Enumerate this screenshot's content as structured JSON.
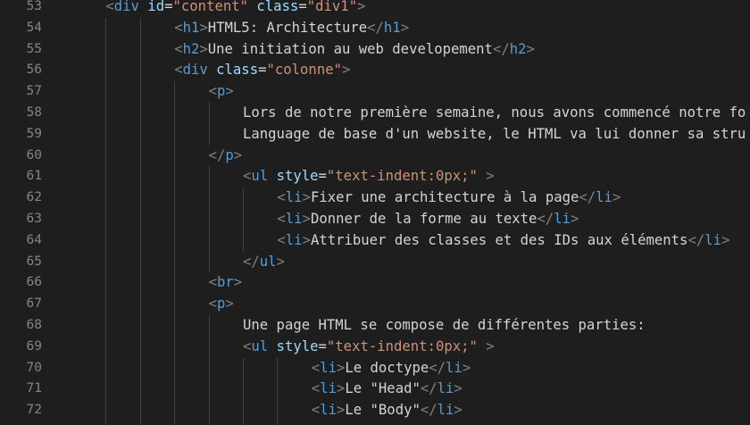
{
  "colors": {
    "background": "#1e1e1e",
    "line_number": "#858585",
    "indent_guide": "#404040",
    "punct": "#808080",
    "tag": "#569cd6",
    "attr": "#9cdcfe",
    "string": "#ce9178",
    "text": "#d4d4d4"
  },
  "lines": [
    {
      "n": "53",
      "indent": 1,
      "tokens": [
        [
          "punct",
          "<"
        ],
        [
          "tag",
          "div"
        ],
        [
          "text",
          " "
        ],
        [
          "attr",
          "id"
        ],
        [
          "text",
          "="
        ],
        [
          "string",
          "\"content\""
        ],
        [
          "text",
          " "
        ],
        [
          "attr",
          "class"
        ],
        [
          "text",
          "="
        ],
        [
          "string",
          "\"div1\""
        ],
        [
          "punct",
          ">"
        ]
      ]
    },
    {
      "n": "54",
      "indent": 3,
      "tokens": [
        [
          "punct",
          "<"
        ],
        [
          "tag",
          "h1"
        ],
        [
          "punct",
          ">"
        ],
        [
          "text",
          "HTML5: Architecture"
        ],
        [
          "punct",
          "</"
        ],
        [
          "tag",
          "h1"
        ],
        [
          "punct",
          ">"
        ]
      ]
    },
    {
      "n": "55",
      "indent": 3,
      "tokens": [
        [
          "punct",
          "<"
        ],
        [
          "tag",
          "h2"
        ],
        [
          "punct",
          ">"
        ],
        [
          "text",
          "Une initiation au web developement"
        ],
        [
          "punct",
          "</"
        ],
        [
          "tag",
          "h2"
        ],
        [
          "punct",
          ">"
        ]
      ]
    },
    {
      "n": "56",
      "indent": 3,
      "tokens": [
        [
          "punct",
          "<"
        ],
        [
          "tag",
          "div"
        ],
        [
          "text",
          " "
        ],
        [
          "attr",
          "class"
        ],
        [
          "text",
          "="
        ],
        [
          "string",
          "\"colonne\""
        ],
        [
          "punct",
          ">"
        ]
      ]
    },
    {
      "n": "57",
      "indent": 4,
      "tokens": [
        [
          "punct",
          "<"
        ],
        [
          "tag",
          "p"
        ],
        [
          "punct",
          ">"
        ]
      ]
    },
    {
      "n": "58",
      "indent": 5,
      "tokens": [
        [
          "text",
          "Lors de notre première semaine, nous avons commencé notre fo"
        ]
      ]
    },
    {
      "n": "59",
      "indent": 5,
      "tokens": [
        [
          "text",
          "Language de base d'un website, le HTML va lui donner sa stru"
        ]
      ]
    },
    {
      "n": "60",
      "indent": 4,
      "tokens": [
        [
          "punct",
          "</"
        ],
        [
          "tag",
          "p"
        ],
        [
          "punct",
          ">"
        ]
      ]
    },
    {
      "n": "61",
      "indent": 5,
      "tokens": [
        [
          "punct",
          "<"
        ],
        [
          "tag",
          "ul"
        ],
        [
          "text",
          " "
        ],
        [
          "attr",
          "style"
        ],
        [
          "text",
          "="
        ],
        [
          "string",
          "\"text-indent:0px;\""
        ],
        [
          "text",
          " "
        ],
        [
          "punct",
          ">"
        ]
      ]
    },
    {
      "n": "62",
      "indent": 6,
      "tokens": [
        [
          "punct",
          "<"
        ],
        [
          "tag",
          "li"
        ],
        [
          "punct",
          ">"
        ],
        [
          "text",
          "Fixer une architecture à la page"
        ],
        [
          "punct",
          "</"
        ],
        [
          "tag",
          "li"
        ],
        [
          "punct",
          ">"
        ]
      ]
    },
    {
      "n": "63",
      "indent": 6,
      "tokens": [
        [
          "punct",
          "<"
        ],
        [
          "tag",
          "li"
        ],
        [
          "punct",
          ">"
        ],
        [
          "text",
          "Donner de la forme au texte"
        ],
        [
          "punct",
          "</"
        ],
        [
          "tag",
          "li"
        ],
        [
          "punct",
          ">"
        ]
      ]
    },
    {
      "n": "64",
      "indent": 6,
      "tokens": [
        [
          "punct",
          "<"
        ],
        [
          "tag",
          "li"
        ],
        [
          "punct",
          ">"
        ],
        [
          "text",
          "Attribuer des classes et des IDs aux éléments"
        ],
        [
          "punct",
          "</"
        ],
        [
          "tag",
          "li"
        ],
        [
          "punct",
          ">"
        ]
      ]
    },
    {
      "n": "65",
      "indent": 5,
      "tokens": [
        [
          "punct",
          "</"
        ],
        [
          "tag",
          "ul"
        ],
        [
          "punct",
          ">"
        ]
      ]
    },
    {
      "n": "66",
      "indent": 4,
      "tokens": [
        [
          "punct",
          "<"
        ],
        [
          "tag",
          "br"
        ],
        [
          "punct",
          ">"
        ]
      ]
    },
    {
      "n": "67",
      "indent": 4,
      "tokens": [
        [
          "punct",
          "<"
        ],
        [
          "tag",
          "p"
        ],
        [
          "punct",
          ">"
        ]
      ]
    },
    {
      "n": "68",
      "indent": 5,
      "tokens": [
        [
          "text",
          "Une page HTML se compose de différentes parties:"
        ]
      ]
    },
    {
      "n": "69",
      "indent": 5,
      "tokens": [
        [
          "punct",
          "<"
        ],
        [
          "tag",
          "ul"
        ],
        [
          "text",
          " "
        ],
        [
          "attr",
          "style"
        ],
        [
          "text",
          "="
        ],
        [
          "string",
          "\"text-indent:0px;\""
        ],
        [
          "text",
          " "
        ],
        [
          "punct",
          ">"
        ]
      ]
    },
    {
      "n": "70",
      "indent": 7,
      "tokens": [
        [
          "punct",
          "<"
        ],
        [
          "tag",
          "li"
        ],
        [
          "punct",
          ">"
        ],
        [
          "text",
          "Le doctype"
        ],
        [
          "punct",
          "</"
        ],
        [
          "tag",
          "li"
        ],
        [
          "punct",
          ">"
        ]
      ]
    },
    {
      "n": "71",
      "indent": 7,
      "tokens": [
        [
          "punct",
          "<"
        ],
        [
          "tag",
          "li"
        ],
        [
          "punct",
          ">"
        ],
        [
          "text",
          "Le \"Head\""
        ],
        [
          "punct",
          "</"
        ],
        [
          "tag",
          "li"
        ],
        [
          "punct",
          ">"
        ]
      ]
    },
    {
      "n": "72",
      "indent": 7,
      "tokens": [
        [
          "punct",
          "<"
        ],
        [
          "tag",
          "li"
        ],
        [
          "punct",
          ">"
        ],
        [
          "text",
          "Le \"Body\""
        ],
        [
          "punct",
          "</"
        ],
        [
          "tag",
          "li"
        ],
        [
          "punct",
          ">"
        ]
      ]
    },
    {
      "n": "",
      "indent": 7,
      "tokens": []
    }
  ]
}
